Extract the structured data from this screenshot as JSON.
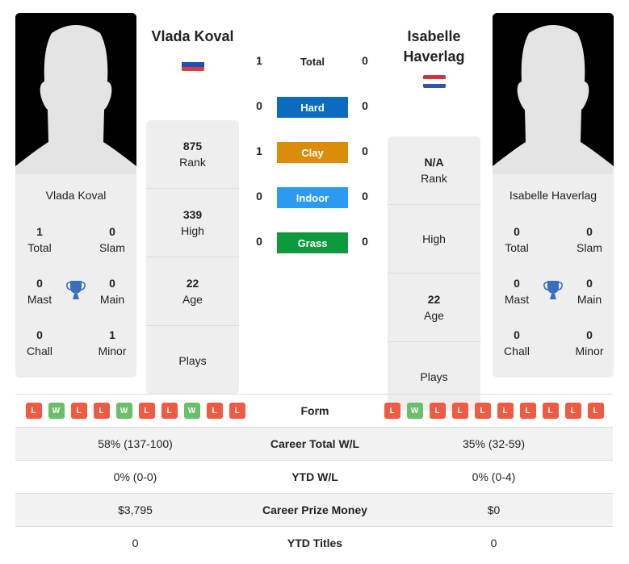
{
  "player1": {
    "name": "Vlada Koval",
    "card_name": "Vlada Koval",
    "flag": "russia-flag",
    "flag_colors": [
      "#ffffff",
      "#1c4fb8",
      "#dd3b3b"
    ],
    "titles": {
      "total": {
        "value": "1",
        "label": "Total"
      },
      "slam": {
        "value": "0",
        "label": "Slam"
      },
      "mast": {
        "value": "0",
        "label": "Mast"
      },
      "main": {
        "value": "0",
        "label": "Main"
      },
      "chall": {
        "value": "0",
        "label": "Chall"
      },
      "minor": {
        "value": "1",
        "label": "Minor"
      }
    },
    "info": {
      "rank": {
        "value": "875",
        "label": "Rank"
      },
      "high": {
        "value": "339",
        "label": "High"
      },
      "age": {
        "value": "22",
        "label": "Age"
      },
      "plays": {
        "value": "",
        "label": "Plays"
      }
    }
  },
  "player2": {
    "name": "Isabelle Haverlag",
    "name_line1": "Isabelle",
    "name_line2": "Haverlag",
    "card_name": "Isabelle Haverlag",
    "flag": "netherlands-flag",
    "flag_colors": [
      "#d2343c",
      "#ffffff",
      "#2f56a6"
    ],
    "titles": {
      "total": {
        "value": "0",
        "label": "Total"
      },
      "slam": {
        "value": "0",
        "label": "Slam"
      },
      "mast": {
        "value": "0",
        "label": "Mast"
      },
      "main": {
        "value": "0",
        "label": "Main"
      },
      "chall": {
        "value": "0",
        "label": "Chall"
      },
      "minor": {
        "value": "0",
        "label": "Minor"
      }
    },
    "info": {
      "rank": {
        "value": "N/A",
        "label": "Rank"
      },
      "high": {
        "value": "",
        "label": "High"
      },
      "age": {
        "value": "22",
        "label": "Age"
      },
      "plays": {
        "value": "",
        "label": "Plays"
      }
    }
  },
  "h2h": {
    "total": {
      "label": "Total",
      "p1": "1",
      "p2": "0"
    },
    "surfaces": [
      {
        "label": "Hard",
        "p1": "0",
        "p2": "0",
        "color": "#0a6bbf"
      },
      {
        "label": "Clay",
        "p1": "1",
        "p2": "0",
        "color": "#dc8c0b"
      },
      {
        "label": "Indoor",
        "p1": "0",
        "p2": "0",
        "color": "#2b9af0"
      },
      {
        "label": "Grass",
        "p1": "0",
        "p2": "0",
        "color": "#0e9a3c"
      }
    ]
  },
  "comparison": {
    "form_label": "Form",
    "p1_form": [
      "L",
      "W",
      "L",
      "L",
      "W",
      "L",
      "L",
      "W",
      "L",
      "L"
    ],
    "p2_form": [
      "L",
      "W",
      "L",
      "L",
      "L",
      "L",
      "L",
      "L",
      "L",
      "L"
    ],
    "rows": [
      {
        "label": "Career Total W/L",
        "p1": "58% (137-100)",
        "p2": "35% (32-59)"
      },
      {
        "label": "YTD W/L",
        "p1": "0% (0-0)",
        "p2": "0% (0-4)"
      },
      {
        "label": "Career Prize Money",
        "p1": "$3,795",
        "p2": "$0"
      },
      {
        "label": "YTD Titles",
        "p1": "0",
        "p2": "0"
      }
    ]
  }
}
